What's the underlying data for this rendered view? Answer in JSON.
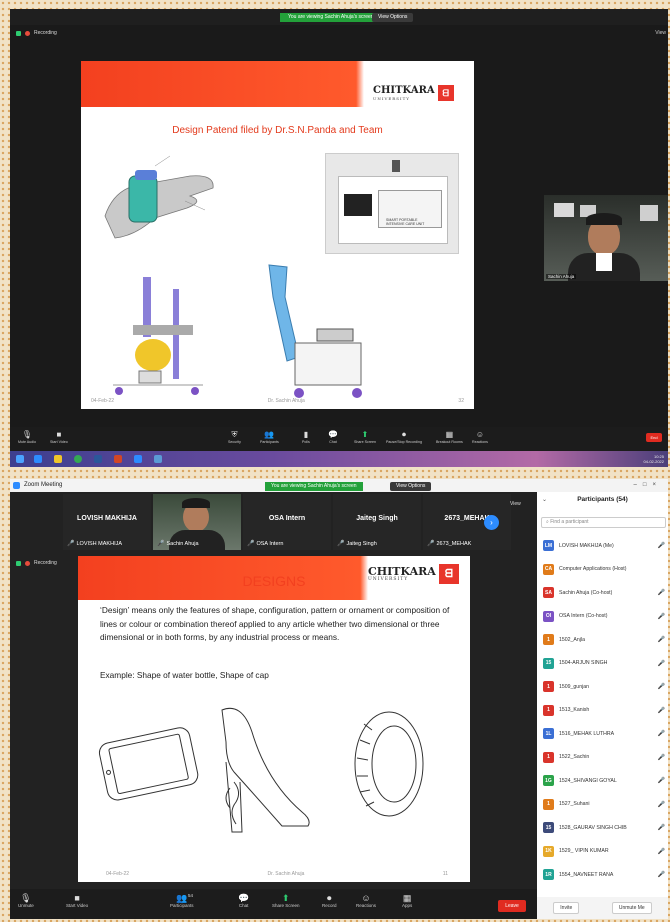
{
  "screenshot1": {
    "banner": "You are viewing Sachin Ahuja's screen",
    "view_options": "View Options",
    "recording": "Recording",
    "view_label": "View",
    "slide": {
      "logo_text": "CHITKARA",
      "logo_sub": "UNIVERSITY",
      "title": "Design Patend filed by  Dr.S.N.Panda and Team",
      "device_label": "SMART PORTABLE INTENSIVE CARE UNIT",
      "footer_date": "04-Feb-22",
      "footer_author": "Dr. Sachin Ahuja",
      "footer_page": "32"
    },
    "camera_name": "Sachin Ahuja",
    "toolbar": [
      {
        "icon": "microphone-icon",
        "label": "Mute Audio",
        "glyph": "🎙"
      },
      {
        "icon": "video-icon",
        "label": "Start Video",
        "glyph": "■"
      },
      {
        "icon": "shield-icon",
        "label": "Security",
        "glyph": "⛨"
      },
      {
        "icon": "participants-icon",
        "label": "Participants",
        "glyph": "👥"
      },
      {
        "icon": "polls-icon",
        "label": "Polls",
        "glyph": "▮"
      },
      {
        "icon": "chat-icon",
        "label": "Chat",
        "glyph": "💬"
      },
      {
        "icon": "share-screen-icon",
        "label": "Share Screen",
        "glyph": "⬆"
      },
      {
        "icon": "record-icon",
        "label": "Pause/Stop Recording",
        "glyph": "⏺"
      },
      {
        "icon": "breakout-icon",
        "label": "Breakout Rooms",
        "glyph": "▦"
      },
      {
        "icon": "reactions-icon",
        "label": "Reactions",
        "glyph": "☺"
      }
    ],
    "end_label": "End",
    "clock_time": "10:25",
    "clock_date": "04-02-2022"
  },
  "screenshot2": {
    "window_title": "Zoom Meeting",
    "banner": "You are viewing Sachin Ahuja's screen",
    "view_options": "View Options",
    "recording": "Recording",
    "view_label": "View",
    "gallery": [
      {
        "big": "LOVISH MAKHIJA",
        "small": "LOVISH MAKHIJA",
        "camera": false
      },
      {
        "big": "",
        "small": "Sachin Ahuja",
        "camera": true
      },
      {
        "big": "OSA Intern",
        "small": "OSA Intern",
        "camera": false
      },
      {
        "big": "Jaiteg Singh",
        "small": "Jaiteg Singh",
        "camera": false
      },
      {
        "big": "2673_MEHAK",
        "small": "2673_MEHAK",
        "camera": false
      }
    ],
    "slide": {
      "title": "DESIGNS",
      "logo_text": "CHITKARA",
      "logo_sub": "UNIVERSITY",
      "body": "‘Design’ means only the features of shape, configuration, pattern or ornament or composition of lines or colour or combination thereof applied to any article whether two dimensional or three dimensional or in both forms, by any industrial process or means.",
      "example": "Example: Shape of water bottle, Shape of cap",
      "footer_date": "04-Feb-22",
      "footer_author": "Dr. Sachin Ahuja",
      "footer_page": "11"
    },
    "participants_panel": {
      "title": "Participants (54)",
      "search_placeholder": "Find a participant",
      "items": [
        {
          "initials": "LM",
          "color": "#3b6fd4",
          "name": "LOVISH MAKHIJA (Me)",
          "mic": "off"
        },
        {
          "initials": "CA",
          "color": "#e07b1a",
          "name": "Computer Applications (Host)",
          "mic": "none"
        },
        {
          "initials": "SA",
          "color": "#d9342b",
          "name": "Sachin Ahuja (Co-host)",
          "mic": "on"
        },
        {
          "initials": "OI",
          "color": "#7b52c4",
          "name": "OSA Intern (Co-host)",
          "mic": "off"
        },
        {
          "initials": "1",
          "color": "#e07b1a",
          "name": "1502_Anjla",
          "mic": "off"
        },
        {
          "initials": "15",
          "color": "#21a394",
          "name": "1504-ARJUN SINGH",
          "mic": "off"
        },
        {
          "initials": "1",
          "color": "#d9342b",
          "name": "1509_gunjan",
          "mic": "off"
        },
        {
          "initials": "1",
          "color": "#d9342b",
          "name": "1513_Kanish",
          "mic": "off"
        },
        {
          "initials": "1L",
          "color": "#3b6fd4",
          "name": "1516_MEHAK LUTHRA",
          "mic": "off"
        },
        {
          "initials": "1",
          "color": "#d9342b",
          "name": "1522_Sachin",
          "mic": "off"
        },
        {
          "initials": "1G",
          "color": "#2ba34a",
          "name": "1524_SHIVANGI GOYAL",
          "mic": "off"
        },
        {
          "initials": "1",
          "color": "#e07b1a",
          "name": "1527_Suhani",
          "mic": "off"
        },
        {
          "initials": "15",
          "color": "#3d4b7a",
          "name": "1528_GAURAV SINGH CHIB",
          "mic": "off"
        },
        {
          "initials": "1K",
          "color": "#e6a92a",
          "name": "1529_ VIPIN KUMAR",
          "mic": "off"
        },
        {
          "initials": "1R",
          "color": "#21a394",
          "name": "1554_NAVNEET RANA",
          "mic": "off"
        }
      ],
      "invite_label": "Invite",
      "unmute_me_label": "Unmute Me"
    },
    "toolbar": [
      {
        "icon": "microphone-muted-icon",
        "label": "Unmute",
        "glyph": "🎙"
      },
      {
        "icon": "video-off-icon",
        "label": "Start Video",
        "glyph": "■"
      },
      {
        "icon": "participants-icon",
        "label": "Participants",
        "glyph": "👥",
        "badge": "54"
      },
      {
        "icon": "chat-icon",
        "label": "Chat",
        "glyph": "💬"
      },
      {
        "icon": "share-screen-icon",
        "label": "Share Screen",
        "glyph": "⬆"
      },
      {
        "icon": "record-icon",
        "label": "Record",
        "glyph": "⏺"
      },
      {
        "icon": "reactions-icon",
        "label": "Reactions",
        "glyph": "☺"
      },
      {
        "icon": "apps-icon",
        "label": "Apps",
        "glyph": "▦"
      }
    ],
    "leave_label": "Leave"
  }
}
